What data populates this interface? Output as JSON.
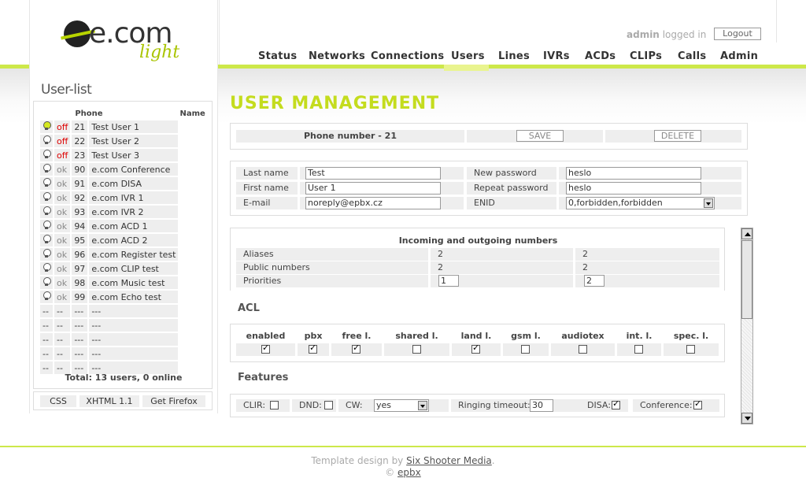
{
  "logo": {
    "text": "e.com",
    "sub": "light"
  },
  "header": {
    "user": "admin",
    "logged_in_text": "logged in",
    "logout_label": "Logout",
    "nav": [
      "Status",
      "Networks",
      "Connections",
      "Users",
      "Lines",
      "IVRs",
      "ACDs",
      "CLIPs",
      "Calls",
      "Admin"
    ],
    "active_nav": "Users",
    "accent_color": "#c4dc1e"
  },
  "sidebar": {
    "title": "User-list",
    "columns": {
      "phone": "Phone",
      "name": "Name"
    },
    "rows": [
      {
        "status": "off",
        "phone": "21",
        "name": "Test User 1",
        "icon": "bulb-on"
      },
      {
        "status": "off",
        "phone": "22",
        "name": "Test User 2",
        "icon": "bulb"
      },
      {
        "status": "off",
        "phone": "23",
        "name": "Test User 3",
        "icon": "bulb"
      },
      {
        "status": "ok",
        "phone": "90",
        "name": "e.com Conference",
        "icon": "bulb"
      },
      {
        "status": "ok",
        "phone": "91",
        "name": "e.com DISA",
        "icon": "bulb"
      },
      {
        "status": "ok",
        "phone": "92",
        "name": "e.com IVR 1",
        "icon": "bulb"
      },
      {
        "status": "ok",
        "phone": "93",
        "name": "e.com IVR 2",
        "icon": "bulb"
      },
      {
        "status": "ok",
        "phone": "94",
        "name": "e.com ACD 1",
        "icon": "bulb"
      },
      {
        "status": "ok",
        "phone": "95",
        "name": "e.com ACD 2",
        "icon": "bulb"
      },
      {
        "status": "ok",
        "phone": "96",
        "name": "e.com Register test",
        "icon": "bulb"
      },
      {
        "status": "ok",
        "phone": "97",
        "name": "e.com CLIP test",
        "icon": "bulb"
      },
      {
        "status": "ok",
        "phone": "98",
        "name": "e.com Music test",
        "icon": "bulb"
      },
      {
        "status": "ok",
        "phone": "99",
        "name": "e.com Echo test",
        "icon": "bulb"
      },
      {
        "empty": true,
        "c1": "--",
        "c2": "--",
        "c3": "---",
        "c4": "---"
      },
      {
        "empty": true,
        "c1": "--",
        "c2": "--",
        "c3": "---",
        "c4": "---"
      },
      {
        "empty": true,
        "c1": "--",
        "c2": "--",
        "c3": "---",
        "c4": "---"
      },
      {
        "empty": true,
        "c1": "--",
        "c2": "--",
        "c3": "---",
        "c4": "---"
      },
      {
        "empty": true,
        "c1": "--",
        "c2": "--",
        "c3": "---",
        "c4": "---"
      }
    ],
    "total": "Total: 13 users, 0 online",
    "footer_buttons": [
      "CSS",
      "XHTML 1.1",
      "Get Firefox"
    ]
  },
  "main": {
    "title": "USER MANAGEMENT",
    "phone_bar": {
      "label": "Phone number - 21",
      "save": "SAVE",
      "delete": "DELETE"
    },
    "form": {
      "last_name_label": "Last name",
      "last_name": "Test",
      "first_name_label": "First name",
      "first_name": "User 1",
      "email_label": "E-mail",
      "email": "noreply@epbx.cz",
      "new_password_label": "New password",
      "new_password": "heslo",
      "repeat_password_label": "Repeat password",
      "repeat_password": "heslo",
      "enid_label": "ENID",
      "enid": "0,forbidden,forbidden"
    },
    "numbers": {
      "title": "Incoming and outgoing numbers",
      "aliases_label": "Aliases",
      "aliases_a": "2",
      "aliases_b": "2",
      "public_label": "Public numbers",
      "public_a": "2",
      "public_b": "2",
      "priorities_label": "Priorities",
      "priority_a": "1",
      "priority_b": "2"
    },
    "acl": {
      "title": "ACL",
      "columns": [
        {
          "label": "enabled",
          "checked": true
        },
        {
          "label": "pbx",
          "checked": true
        },
        {
          "label": "free l.",
          "checked": true
        },
        {
          "label": "shared l.",
          "checked": false
        },
        {
          "label": "land l.",
          "checked": true
        },
        {
          "label": "gsm l.",
          "checked": false
        },
        {
          "label": "audiotex",
          "checked": false
        },
        {
          "label": "int. l.",
          "checked": false
        },
        {
          "label": "spec. l.",
          "checked": false
        }
      ]
    },
    "features": {
      "title": "Features",
      "clir_label": "CLIR:",
      "clir": false,
      "dnd_label": "DND:",
      "dnd": false,
      "cw_label": "CW:",
      "cw": "yes",
      "ringing_label": "Ringing timeout:",
      "ringing": "30",
      "disa_label": "DISA:",
      "disa": true,
      "conference_label": "Conference:",
      "conference": true
    }
  },
  "footer": {
    "line1_prefix": "Template design by",
    "line1_link": "Six Shooter Media",
    "line1_suffix": ".",
    "line2_prefix": "©",
    "line2_link": "epbx"
  }
}
